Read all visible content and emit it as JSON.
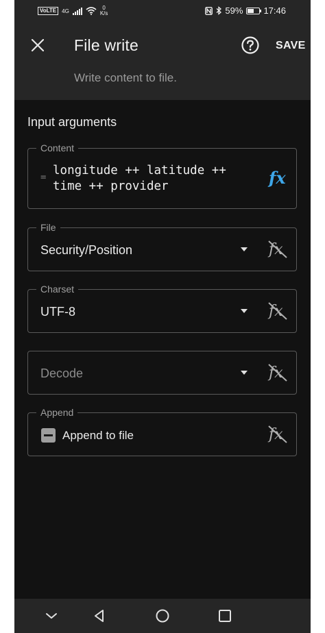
{
  "status_bar": {
    "volte": "VoLTE",
    "network": "4G",
    "speed_value": "0",
    "speed_unit": "K/s",
    "battery_percent": "59%",
    "battery_level": 0.59,
    "time": "17:46"
  },
  "app_bar": {
    "title": "File write",
    "subtitle": "Write content to file.",
    "save_label": "SAVE"
  },
  "form": {
    "section_title": "Input arguments",
    "content": {
      "label": "Content",
      "value": "longitude ++ latitude ++\ntime ++ provider",
      "eq_symbol": "=",
      "fx_symbol": "fx"
    },
    "file": {
      "label": "File",
      "value": "Security/Position"
    },
    "charset": {
      "label": "Charset",
      "value": "UTF-8"
    },
    "decode": {
      "placeholder": "Decode"
    },
    "append": {
      "label": "Append",
      "checkbox_label": "Append to file",
      "checkbox_state": "indeterminate"
    }
  },
  "colors": {
    "background": "#121212",
    "app_bar": "#262626",
    "accent_fx": "#3ea6e8",
    "border": "#5a5a5a"
  },
  "icons": {
    "close": "close-icon",
    "help": "help-circle-icon",
    "fx_active": "function-icon",
    "fx_disabled": "function-off-icon",
    "dropdown": "caret-down-icon"
  }
}
